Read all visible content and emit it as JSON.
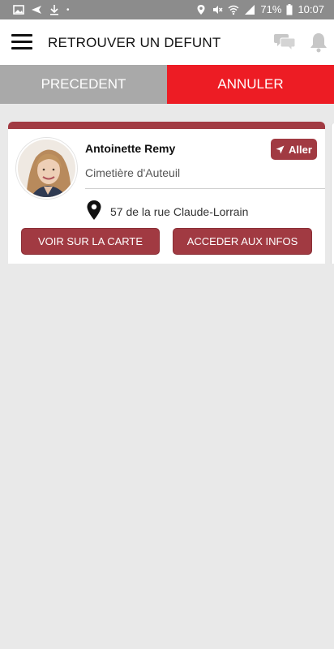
{
  "status_bar": {
    "battery_percent": "71%",
    "time": "10:07"
  },
  "app_bar": {
    "title": "RETROUVER UN DEFUNT"
  },
  "tabs": [
    {
      "label": "PRECEDENT"
    },
    {
      "label": "ANNULER"
    }
  ],
  "result": {
    "name": "Antoinette Remy",
    "cemetery": "Cimetière d'Auteuil",
    "address": "57 de la rue Claude-Lorrain",
    "go_label": "Aller",
    "map_button": "VOIR SUR LA CARTE",
    "info_button": "ACCEDER AUX INFOS"
  },
  "colors": {
    "accent": "#a13a42",
    "cancel": "#ed1c24",
    "previous": "#a9a9a9"
  }
}
